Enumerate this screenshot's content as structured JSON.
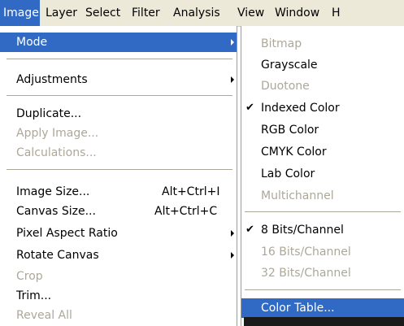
{
  "menubar": {
    "items": [
      "Image",
      "Layer",
      "Select",
      "Filter",
      "Analysis",
      "View",
      "Window",
      "H"
    ]
  },
  "image_menu": {
    "items": [
      {
        "label": "Mode",
        "highlighted": true,
        "has_submenu": true
      },
      {
        "label": "Adjustments",
        "has_submenu": true
      },
      {
        "label": "Duplicate..."
      },
      {
        "label": "Apply Image...",
        "disabled": true
      },
      {
        "label": "Calculations...",
        "disabled": true
      },
      {
        "label": "Image Size...",
        "shortcut": "Alt+Ctrl+I"
      },
      {
        "label": "Canvas Size...",
        "shortcut": "Alt+Ctrl+C"
      },
      {
        "label": "Pixel Aspect Ratio",
        "has_submenu": true
      },
      {
        "label": "Rotate Canvas",
        "has_submenu": true
      },
      {
        "label": "Crop",
        "disabled": true
      },
      {
        "label": "Trim..."
      },
      {
        "label": "Reveal All",
        "disabled": true
      }
    ]
  },
  "mode_submenu": {
    "items": [
      {
        "label": "Bitmap",
        "disabled": true
      },
      {
        "label": "Grayscale"
      },
      {
        "label": "Duotone",
        "disabled": true
      },
      {
        "label": "Indexed Color",
        "checked": true
      },
      {
        "label": "RGB Color"
      },
      {
        "label": "CMYK Color"
      },
      {
        "label": "Lab Color"
      },
      {
        "label": "Multichannel",
        "disabled": true
      },
      {
        "label": "8 Bits/Channel",
        "checked": true
      },
      {
        "label": "16 Bits/Channel",
        "disabled": true
      },
      {
        "label": "32 Bits/Channel",
        "disabled": true
      },
      {
        "label": "Color Table...",
        "highlighted": true
      }
    ],
    "check_glyph": "✔"
  },
  "colors": {
    "menubar_bg": "#ece9d8",
    "highlight": "#316ac5",
    "disabled_text": "#aca899"
  }
}
